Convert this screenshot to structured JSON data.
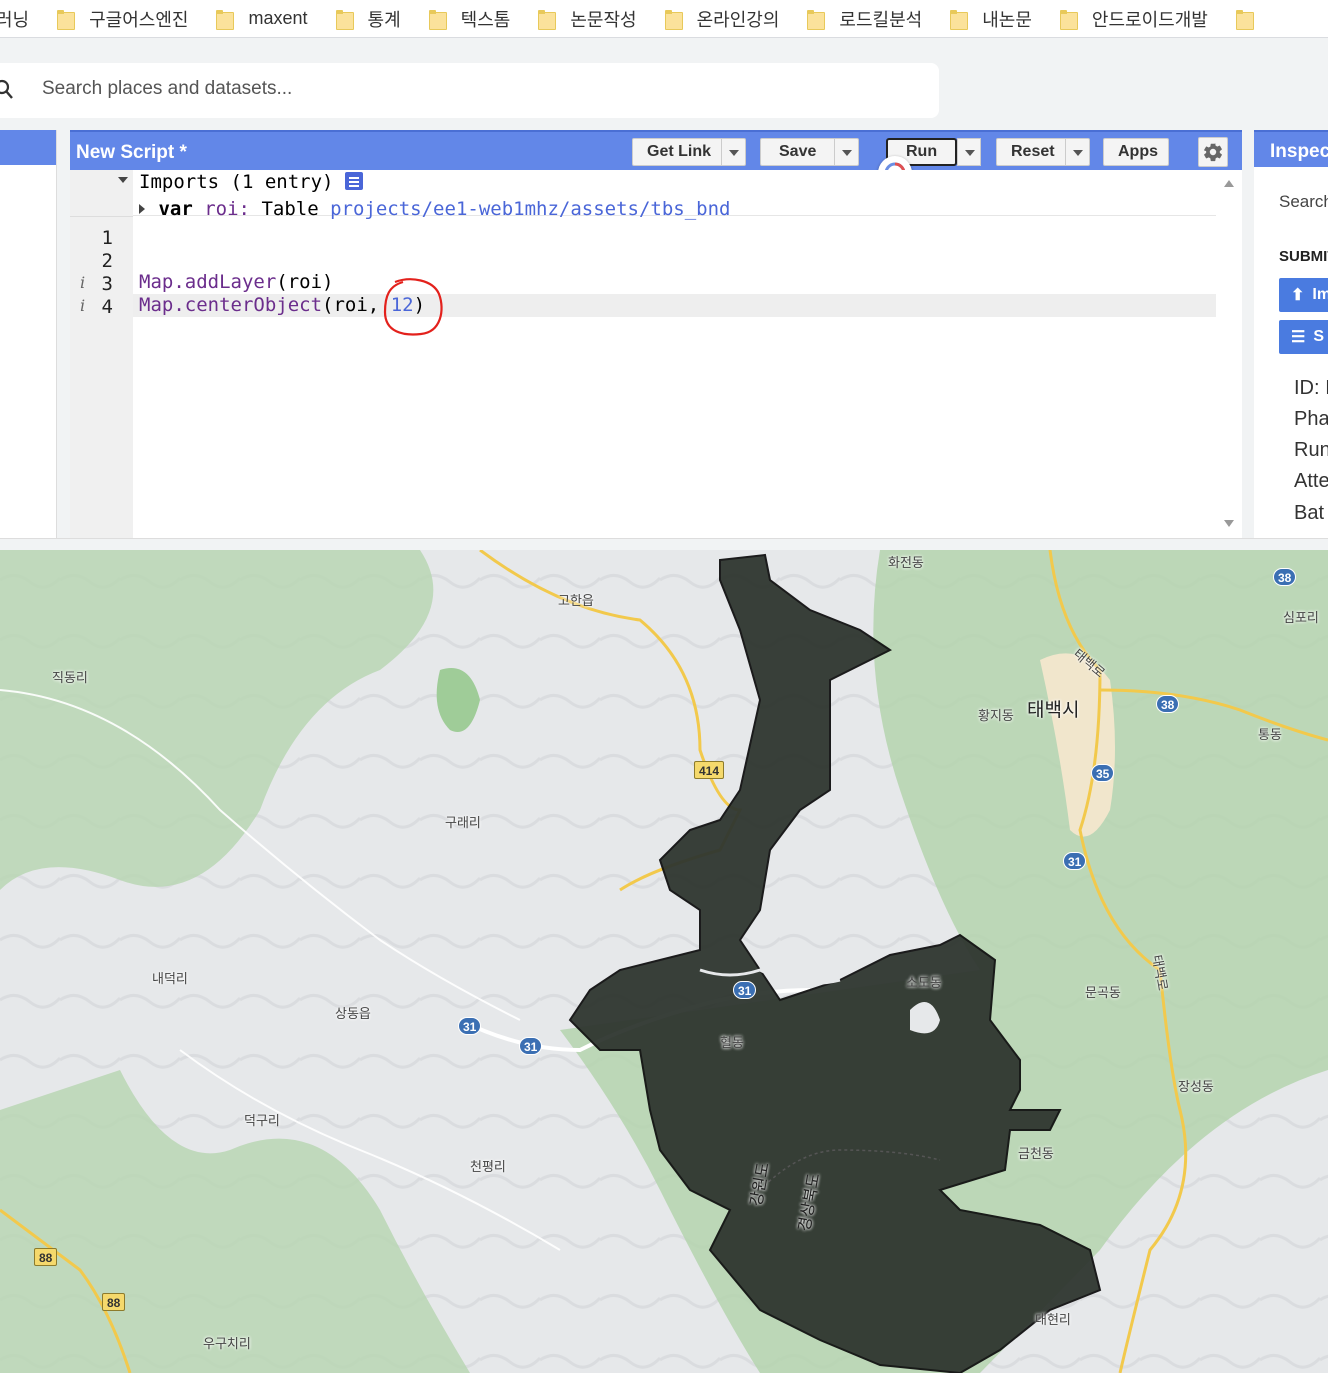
{
  "bookmarks": [
    "러닝",
    "구글어스엔진",
    "maxent",
    "통계",
    "텍스톰",
    "논문작성",
    "온라인강의",
    "로드킬분석",
    "내논문",
    "안드로이드개발"
  ],
  "search": {
    "placeholder": "Search places and datasets..."
  },
  "editor": {
    "title": "New Script *",
    "buttons": {
      "get_link": "Get Link",
      "save": "Save",
      "run": "Run",
      "reset": "Reset",
      "apps": "Apps"
    },
    "imports_header": "Imports (1 entry)",
    "import_line": {
      "keyword": "var",
      "name": "roi:",
      "type": "Table",
      "path": "projects/ee1-web1mhz/assets/tbs_bnd"
    },
    "line_numbers": [
      "1",
      "2",
      "3",
      "4"
    ],
    "lines": {
      "l3_fn": "Map.addLayer",
      "l3_args": "(roi)",
      "l4_fn": "Map.centerObject",
      "l4_args_a": "(roi,",
      "l4_num": "12",
      "l4_args_b": ")"
    },
    "annotation_color": "#e3211c"
  },
  "inspector": {
    "title": "Inspector",
    "search": "Search",
    "submit": "SUBMIT",
    "btn1": "Im",
    "btn2": "S",
    "fields": [
      "ID: I",
      "Pha",
      "Run",
      "Atte",
      "Bat"
    ]
  },
  "map": {
    "labels": {
      "jikdong": "직동리",
      "gohan": "고한읍",
      "hwajeon": "화전동",
      "simpo": "심포리",
      "hwangji": "황지동",
      "taebaek": "태백시",
      "tongdong": "통동",
      "guraeri": "구래리",
      "naedeok": "내덕리",
      "sangdong": "상동읍",
      "hyeoldong": "혈동",
      "sodo": "소도동",
      "mungok": "문곡동",
      "jangseong": "장성동",
      "deokgu": "덕구리",
      "cheonpyeong": "천평리",
      "geumcheon": "금천동",
      "gangwon": "강원도",
      "gyeongbuk": "경상북도",
      "daehyeon": "대현리",
      "ugu": "우구치리",
      "taebaekro": "태백로",
      "taebaekro2": "태백로"
    },
    "shields": {
      "r38a": "38",
      "r38b": "38",
      "r35": "35",
      "r31a": "31",
      "r31b": "31",
      "r31c": "31",
      "r31d": "31",
      "r414": "414",
      "r88a": "88",
      "r88b": "88"
    },
    "region_fill": "#2f3630"
  }
}
